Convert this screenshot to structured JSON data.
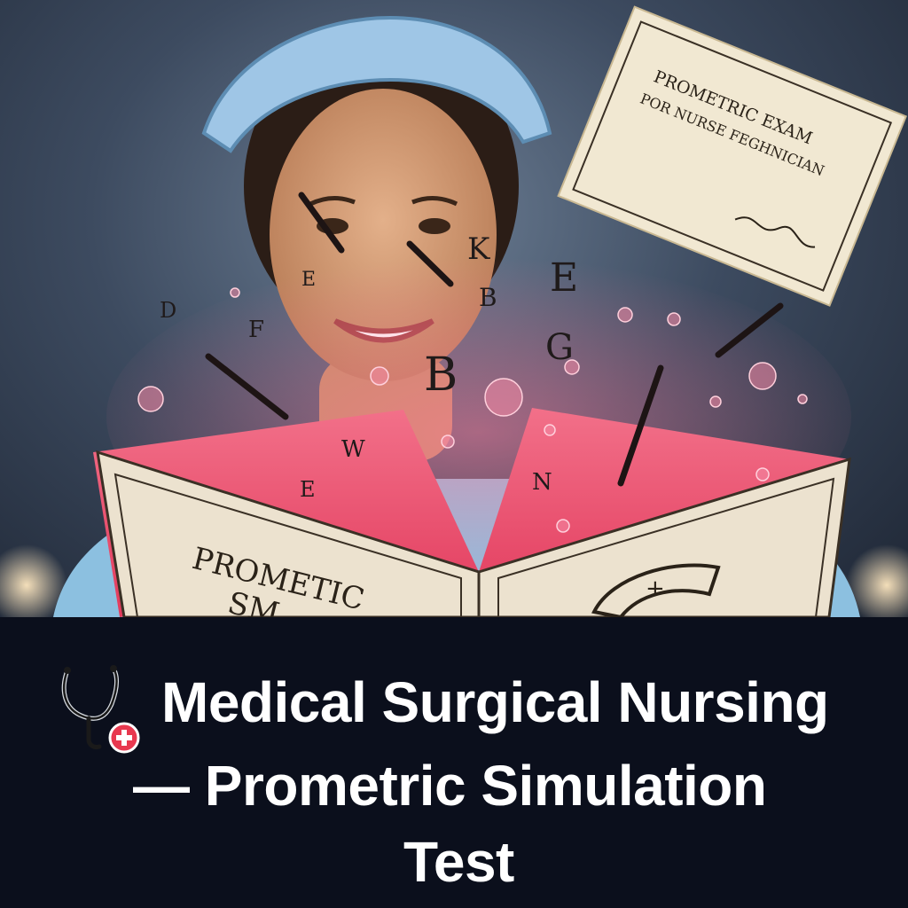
{
  "image": {
    "certificate_text_line1": "PROMETRIC EXAM",
    "certificate_text_line2": "POR NURSE FEGHNICIAN",
    "booklet_text_line1": "PROMETIC",
    "booklet_text_line2": "SM",
    "floating_letters": [
      "D",
      "E",
      "K",
      "B",
      "E",
      "G",
      "B",
      "W",
      "E",
      "N",
      "F"
    ]
  },
  "caption": {
    "icon": "stethoscope-icon",
    "line1": "Medical Surgical Nursing",
    "line2": "— Prometric Simulation",
    "line3": "Test"
  },
  "colors": {
    "background": "#0b0f1c",
    "accent_pink": "#f0506e",
    "text": "#ffffff"
  }
}
